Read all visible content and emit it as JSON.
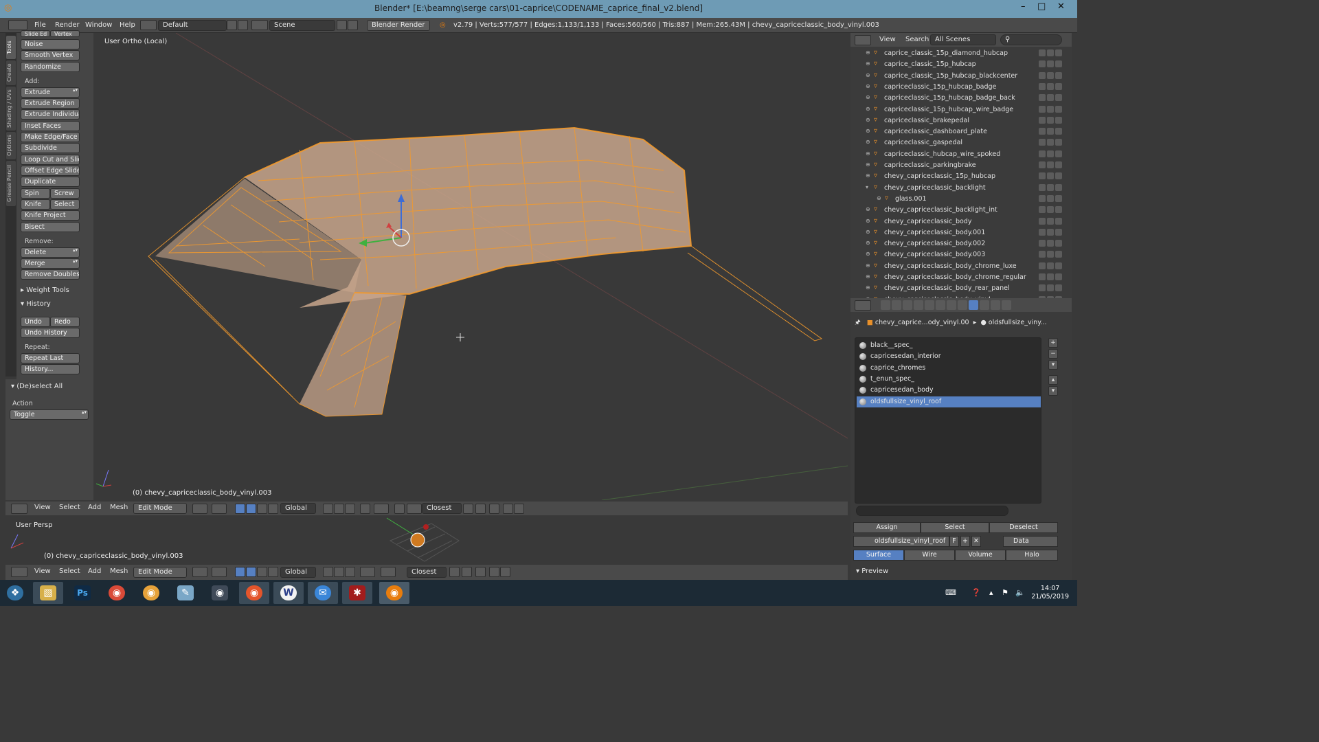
{
  "window": {
    "title": "Blender* [E:\\beamng\\serge cars\\01-caprice\\CODENAME_caprice_final_v2.blend]",
    "minimize": "–",
    "maximize": "□",
    "close": "✕"
  },
  "menu": {
    "file": "File",
    "render": "Render",
    "window": "Window",
    "help": "Help"
  },
  "layout": "Default",
  "scene": "Scene",
  "engine": "Blender Render",
  "stats": "v2.79 | Verts:577/577 | Edges:1,133/1,133 | Faces:560/560 | Tris:887 | Mem:265.43M | chevy_capriceclassic_body_vinyl.003",
  "tool_tabs": [
    "Tools",
    "Create",
    "Shading / UVs",
    "Options",
    "Grease Pencil"
  ],
  "tools": {
    "slide_edge": "Slide Ed",
    "vertex": "Vertex",
    "noise": "Noise",
    "smooth_vertex": "Smooth Vertex",
    "randomize": "Randomize",
    "add_label": "Add:",
    "extrude": "Extrude",
    "extrude_region": "Extrude Region",
    "extrude_individual": "Extrude Individual",
    "inset_faces": "Inset Faces",
    "make_edge_face": "Make Edge/Face",
    "subdivide": "Subdivide",
    "loop_cut": "Loop Cut and Slide",
    "offset_edge_slide": "Offset Edge Slide",
    "duplicate": "Duplicate",
    "spin": "Spin",
    "screw": "Screw",
    "knife": "Knife",
    "select": "Select",
    "knife_project": "Knife Project",
    "bisect": "Bisect",
    "remove_label": "Remove:",
    "delete": "Delete",
    "merge": "Merge",
    "remove_doubles": "Remove Doubles",
    "weight_tools": "Weight Tools",
    "history": "History",
    "undo": "Undo",
    "redo": "Redo",
    "undo_history": "Undo History",
    "repeat_label": "Repeat:",
    "repeat_last": "Repeat Last",
    "history_btn": "History..."
  },
  "operator": {
    "title": "(De)select All",
    "action_label": "Action",
    "action_value": "Toggle"
  },
  "viewport": {
    "view_name": "User Ortho (Local)",
    "object_label": "(0) chevy_capriceclassic_body_vinyl.003"
  },
  "viewport_header": {
    "view": "View",
    "select": "Select",
    "add": "Add",
    "mesh": "Mesh",
    "mode": "Edit Mode",
    "orientation": "Global",
    "snap": "Closest"
  },
  "viewport2": {
    "view_name": "User Persp",
    "object_label": "(0) chevy_capriceclassic_body_vinyl.003"
  },
  "outliner": {
    "view": "View",
    "search": "Search",
    "filter": "All Scenes",
    "rows": [
      {
        "name": "caprice_classic_15p_diamond_hubcap",
        "indent": 0,
        "expanded": false
      },
      {
        "name": "caprice_classic_15p_hubcap",
        "indent": 0,
        "expanded": false
      },
      {
        "name": "caprice_classic_15p_hubcap_blackcenter",
        "indent": 0,
        "expanded": false
      },
      {
        "name": "capriceclassic_15p_hubcap_badge",
        "indent": 0,
        "expanded": false
      },
      {
        "name": "capriceclassic_15p_hubcap_badge_back",
        "indent": 0,
        "expanded": false
      },
      {
        "name": "capriceclassic_15p_hubcap_wire_badge",
        "indent": 0,
        "expanded": false
      },
      {
        "name": "capriceclassic_brakepedal",
        "indent": 0,
        "expanded": false
      },
      {
        "name": "capriceclassic_dashboard_plate",
        "indent": 0,
        "expanded": false
      },
      {
        "name": "capriceclassic_gaspedal",
        "indent": 0,
        "expanded": false
      },
      {
        "name": "capriceclassic_hubcap_wire_spoked",
        "indent": 0,
        "expanded": false
      },
      {
        "name": "capriceclassic_parkingbrake",
        "indent": 0,
        "expanded": false
      },
      {
        "name": "chevy_capriceclassic_15p_hubcap",
        "indent": 0,
        "expanded": false
      },
      {
        "name": "chevy_capriceclassic_backlight",
        "indent": 0,
        "expanded": true
      },
      {
        "name": "glass.001",
        "indent": 1,
        "expanded": false
      },
      {
        "name": "chevy_capriceclassic_backlight_int",
        "indent": 0,
        "expanded": false
      },
      {
        "name": "chevy_capriceclassic_body",
        "indent": 0,
        "expanded": false
      },
      {
        "name": "chevy_capriceclassic_body.001",
        "indent": 0,
        "expanded": false
      },
      {
        "name": "chevy_capriceclassic_body.002",
        "indent": 0,
        "expanded": false
      },
      {
        "name": "chevy_capriceclassic_body.003",
        "indent": 0,
        "expanded": false
      },
      {
        "name": "chevy_capriceclassic_body_chrome_luxe",
        "indent": 0,
        "expanded": false
      },
      {
        "name": "chevy_capriceclassic_body_chrome_regular",
        "indent": 0,
        "expanded": false
      },
      {
        "name": "chevy_capriceclassic_body_rear_panel",
        "indent": 0,
        "expanded": false
      },
      {
        "name": "chevy_capriceclassic_body_vinyl",
        "indent": 0,
        "expanded": false
      }
    ]
  },
  "properties": {
    "breadcrumb_object": "chevy_caprice...ody_vinyl.00",
    "breadcrumb_material": "oldsfullsize_viny...",
    "materials": [
      "black__spec_",
      "capricesedan_interior",
      "caprice_chromes",
      "t_enun_spec_",
      "capricesedan_body",
      "oldsfullsize_vinyl_roof"
    ],
    "selected_material": "oldsfullsize_vinyl_roof",
    "assign": "Assign",
    "select": "Select",
    "deselect": "Deselect",
    "material_name": "oldsfullsize_vinyl_roof",
    "fake_user": "F",
    "link": "Data",
    "tabs": [
      "Surface",
      "Wire",
      "Volume",
      "Halo"
    ],
    "active_tab": "Surface",
    "preview": "Preview"
  },
  "taskbar": {
    "apps": [
      "start",
      "explorer",
      "photoshop",
      "chrome",
      "blender-alt",
      "notepad",
      "discord",
      "firefox",
      "w-app",
      "messenger",
      "game",
      "blender"
    ],
    "time": "14:07",
    "date": "21/05/2019"
  },
  "colors": {
    "accent": "#5680c2",
    "selection": "#f39a2c",
    "titlebar": "#6e9bb5"
  }
}
